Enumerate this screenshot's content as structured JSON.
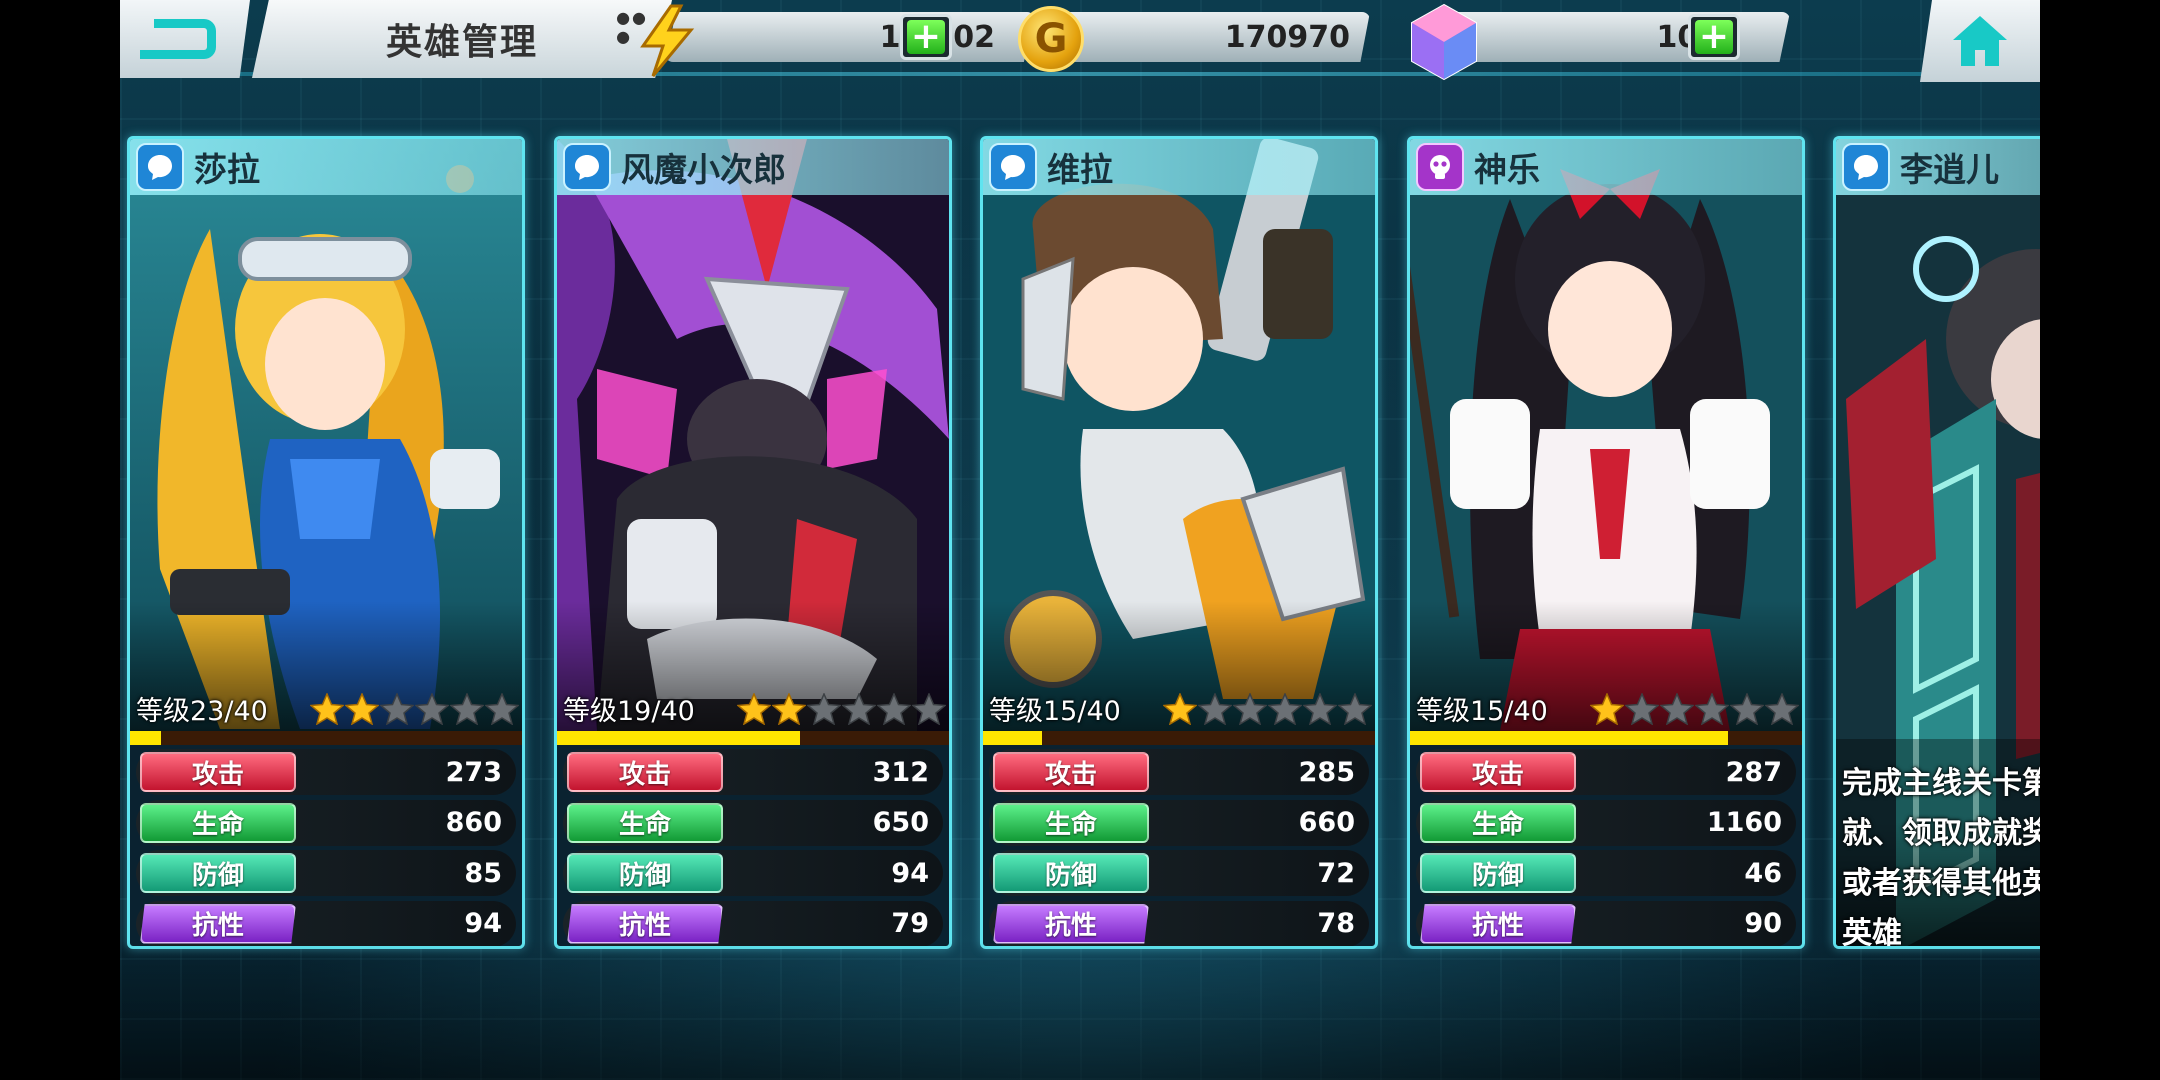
{
  "header": {
    "title": "英雄管理",
    "energy": "15/102",
    "gold": "170970",
    "gems": "1020"
  },
  "icons": [
    "back-icon",
    "lightning-icon",
    "gold-coin-icon",
    "gem-icon",
    "plus-icon",
    "home-icon",
    "element-water-icon",
    "element-spirit-icon",
    "star-icon"
  ],
  "colors": {
    "card_border": "#5fe4f0",
    "xp_bar": "#ffe600",
    "attack": "#c3142f",
    "hp": "#129a35",
    "defense": "#149a76",
    "resistance": "#7a22c4"
  },
  "stat_labels": {
    "attack": "攻击",
    "hp": "生命",
    "defense": "防御",
    "resistance": "抗性"
  },
  "heroes": [
    {
      "name": "莎拉",
      "element": "water",
      "level": "等级23/40",
      "xp_fraction": 0.08,
      "stars_filled": 2,
      "stars_total": 6,
      "attack": "273",
      "hp": "860",
      "defense": "85",
      "resistance": "94"
    },
    {
      "name": "风魔小次郎",
      "element": "water",
      "level": "等级19/40",
      "xp_fraction": 0.62,
      "stars_filled": 2,
      "stars_total": 6,
      "attack": "312",
      "hp": "650",
      "defense": "94",
      "resistance": "79"
    },
    {
      "name": "维拉",
      "element": "water",
      "level": "等级15/40",
      "xp_fraction": 0.15,
      "stars_filled": 1,
      "stars_total": 6,
      "attack": "285",
      "hp": "660",
      "defense": "72",
      "resistance": "78"
    },
    {
      "name": "神乐",
      "element": "spirit",
      "level": "等级15/40",
      "xp_fraction": 0.81,
      "stars_filled": 1,
      "stars_total": 6,
      "attack": "287",
      "hp": "1160",
      "defense": "46",
      "resistance": "90"
    },
    {
      "name": "李逍儿",
      "element": "water",
      "locked": true,
      "unlock_text": [
        "完成主线关卡第",
        "就、领取成就奖",
        "或者获得其他英",
        "英雄"
      ]
    }
  ]
}
